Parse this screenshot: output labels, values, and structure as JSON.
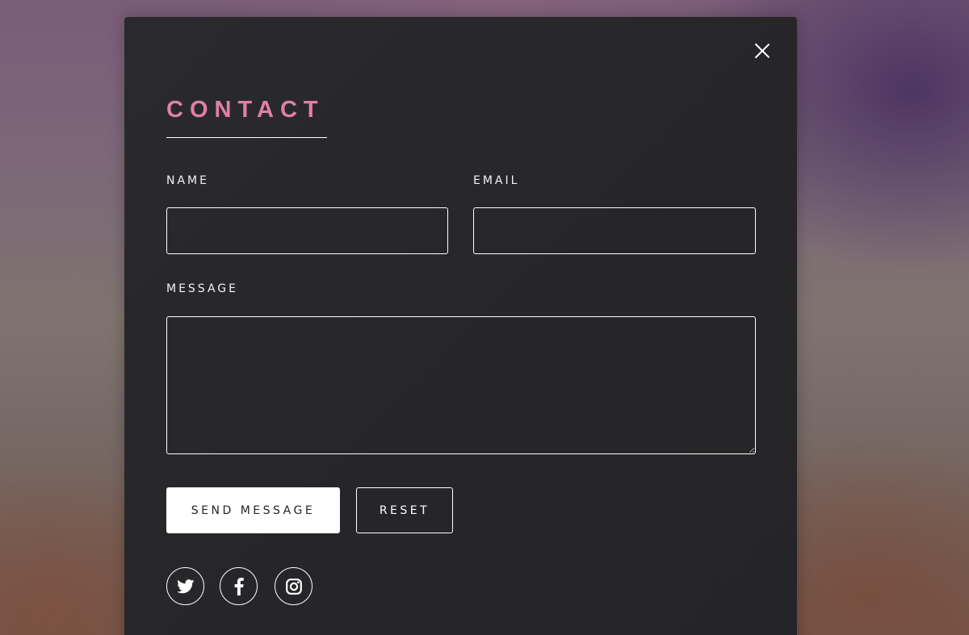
{
  "modal": {
    "title": "CONTACT",
    "accent_color": "#e27fa3",
    "close_icon": "close-icon"
  },
  "form": {
    "name_label": "NAME",
    "email_label": "EMAIL",
    "message_label": "MESSAGE",
    "name_value": "",
    "email_value": "",
    "message_value": "",
    "send_label": "SEND MESSAGE",
    "reset_label": "RESET"
  },
  "social": [
    {
      "icon": "twitter-icon"
    },
    {
      "icon": "facebook-icon"
    },
    {
      "icon": "instagram-icon"
    }
  ]
}
